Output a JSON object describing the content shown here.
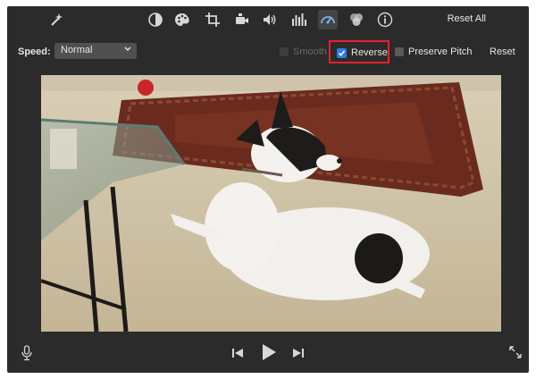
{
  "toolbar": {
    "icons": [
      "magic-wand-icon",
      "color-balance-icon",
      "color-palette-icon",
      "crop-icon",
      "stabilization-camera-icon",
      "volume-icon",
      "equalizer-icon",
      "speedometer-icon",
      "overlay-circles-icon",
      "info-icon"
    ],
    "reset_all": "Reset All"
  },
  "speed": {
    "label": "Speed:",
    "value": "Normal",
    "smooth_label": "Smooth",
    "smooth_checked": false,
    "smooth_enabled": false,
    "reverse_label": "Reverse",
    "reverse_checked": true,
    "preserve_pitch_label": "Preserve Pitch",
    "preserve_pitch_checked": false,
    "reset_label": "Reset"
  },
  "video": {
    "description_icon": "video-preview"
  },
  "playback": {
    "icons": [
      "microphone-icon",
      "skip-back-icon",
      "play-icon",
      "skip-forward-icon",
      "fullscreen-icon"
    ]
  },
  "colors": {
    "highlight": "#e8202a",
    "checkbox_checked": "#2f7ce0",
    "window_bg": "#2b2b2b"
  }
}
